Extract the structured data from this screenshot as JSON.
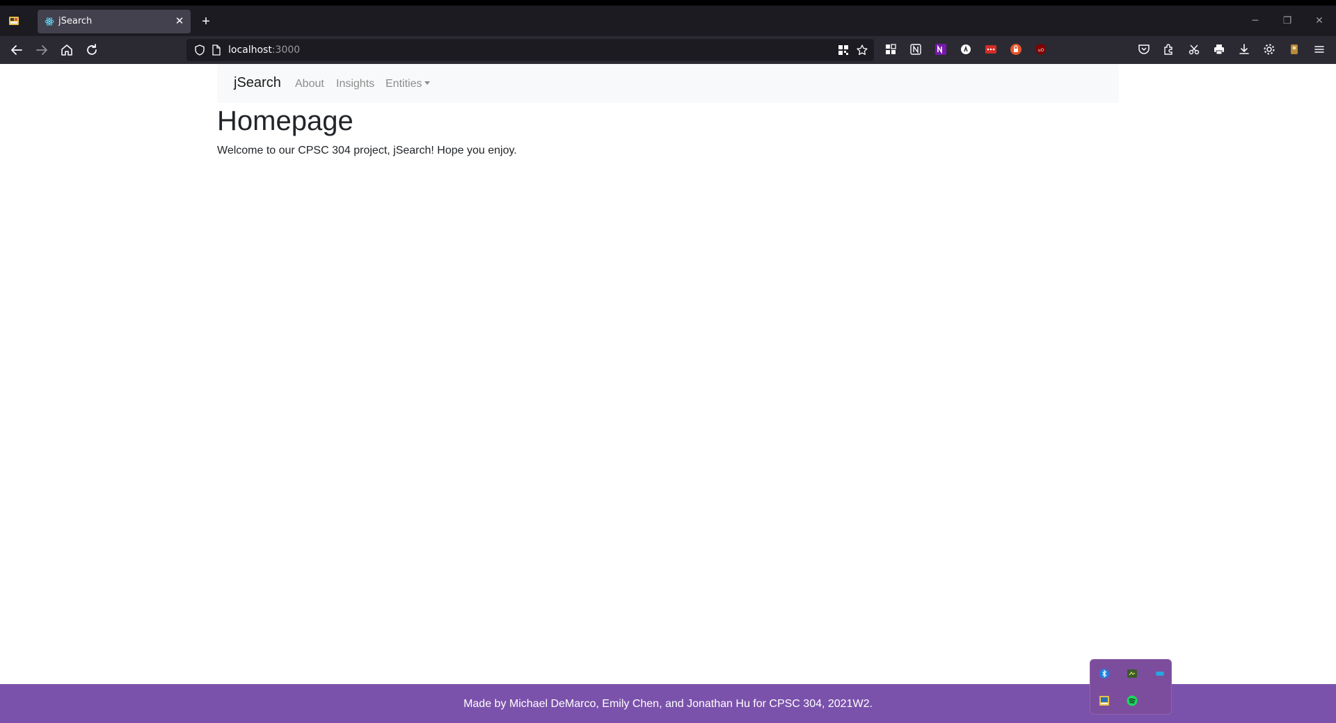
{
  "browser": {
    "tab_title": "jSearch",
    "new_tab_symbol": "+",
    "close_symbol": "✕",
    "url_host": "localhost",
    "url_port": ":3000",
    "window_controls": {
      "minimize": "─",
      "restore": "❐",
      "close": "✕"
    }
  },
  "page": {
    "brand": "jSearch",
    "nav_links": [
      "About",
      "Insights",
      "Entities"
    ],
    "title": "Homepage",
    "welcome_text": "Welcome to our CPSC 304 project, jSearch! Hope you enjoy.",
    "footer_text": "Made by Michael DeMarco, Emily Chen, and Jonathan Hu for CPSC 304, 2021W2."
  },
  "colors": {
    "footer_bg": "#7b52ab",
    "navbar_bg": "#f8f9fa",
    "browser_dark": "#1c1b22",
    "toolbar": "#2b2a33"
  },
  "tray": {
    "icons": [
      "bluetooth-icon",
      "app-icon",
      "chat-icon",
      "photos-icon",
      "spotify-icon"
    ]
  }
}
